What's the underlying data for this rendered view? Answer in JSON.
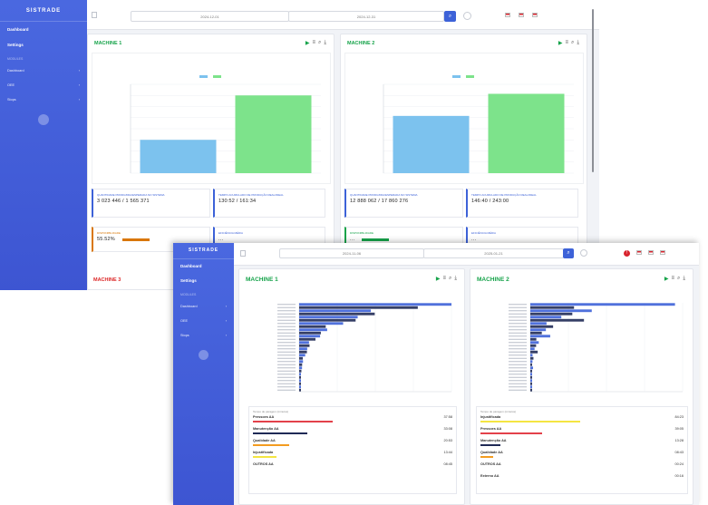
{
  "brand": "SISTRADE",
  "menu": {
    "dashboard": "Dashboard",
    "settings": "Settings",
    "caption": "MODULES",
    "submenus": [
      "Dashboard",
      "OEE",
      "Stops"
    ]
  },
  "shotA": {
    "date_from": "2024-12-01",
    "date_to": "2024-12-31",
    "machines": [
      {
        "title": "MACHINE 1",
        "kpis": [
          {
            "label": "Quantidade produzida/esperada no sistema",
            "value": "3 023 446 / 1 565 371"
          },
          {
            "label": "Tempo acumulado de produção real/ideal",
            "value": "130:52 / 161:34"
          },
          {
            "label": "Disponibilidade",
            "value": "55.52%"
          },
          {
            "label": "Eficiência média",
            "value": "..."
          }
        ]
      },
      {
        "title": "MACHINE 2",
        "kpis": [
          {
            "label": "Quantidade produzida/esperada no sistema",
            "value": "12 888 062 / 17 860 276"
          },
          {
            "label": "Tempo acumulado de produção real/ideal",
            "value": "146:40 / 243:00"
          },
          {
            "label": "Disponibilidade",
            "value": "..."
          },
          {
            "label": "Eficiência média",
            "value": "..."
          }
        ]
      }
    ],
    "machine3_title": "MACHINE 3"
  },
  "shotB": {
    "date_from": "2024-11-06",
    "date_to": "2025-01-21",
    "alert": "!",
    "machines": [
      {
        "title": "MACHINE 1",
        "stops_caption": "Tempo de paragem (minutos)",
        "stops": [
          {
            "name": "Pressoes AA",
            "time": "37:58"
          },
          {
            "name": "Manutenção AA",
            "time": "33:08"
          },
          {
            "name": "Qualidade AA",
            "time": "20:53"
          },
          {
            "name": "Injustificada",
            "time": "13:44"
          },
          {
            "name": "OUTROS AA",
            "time": "08:45"
          }
        ]
      },
      {
        "title": "MACHINE 2",
        "stops_caption": "Tempo de paragem (minutos)",
        "stops": [
          {
            "name": "Injustificada",
            "time": "84:23"
          },
          {
            "name": "Pressoes AA",
            "time": "39:05"
          },
          {
            "name": "Manutenção AA",
            "time": "13:28"
          },
          {
            "name": "Qualidade AA",
            "time": "08:43"
          },
          {
            "name": "OUTROS AA",
            "time": "00:24"
          },
          {
            "name": "Externo AA",
            "time": "00:16"
          }
        ]
      }
    ]
  },
  "colors": {
    "sidebar": "#4a68e0",
    "machine_title": "#16a34a",
    "machine3_title": "#dc2626",
    "bar_produced": "#7cc2ee",
    "bar_ideal": "#7de38b",
    "stop_bar_red": "#e3414a",
    "stop_bar_navy": "#1f2a55",
    "stop_bar_yellow": "#f4e542",
    "stop_bar_orange": "#f39c20"
  },
  "chart_data": [
    {
      "type": "bar",
      "categories": [
        "Produced",
        "Ideal"
      ],
      "values": [
        1500000,
        3500000
      ],
      "ylim": [
        0,
        4000000
      ]
    },
    {
      "type": "bar",
      "categories": [
        "Produced",
        "Ideal"
      ],
      "values": [
        12888062,
        17860276
      ],
      "ylim": [
        0,
        20000000
      ]
    }
  ]
}
